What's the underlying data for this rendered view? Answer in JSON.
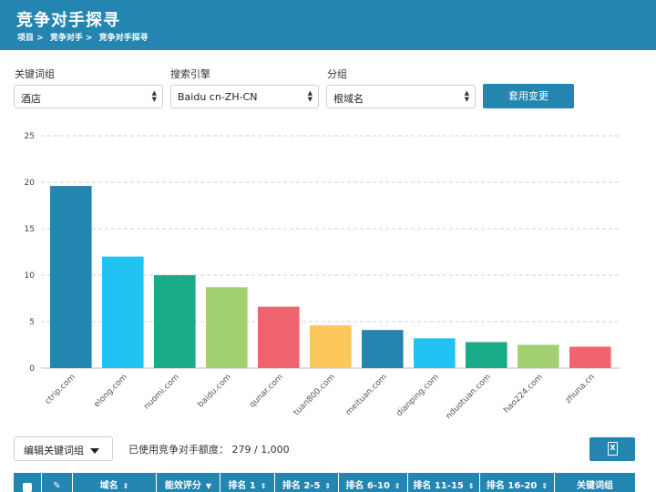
{
  "header": {
    "title": "竞争对手探寻",
    "breadcrumb": [
      "项目 >",
      "竞争对手 >",
      "竞争对手探寻"
    ]
  },
  "filters": {
    "keyword_group": {
      "label": "关键词组",
      "value": "酒店"
    },
    "search_engine": {
      "label": "搜索引擎",
      "value": "Baidu cn-ZH-CN"
    },
    "grouping": {
      "label": "分组",
      "value": "根域名"
    },
    "apply_label": "套用变更"
  },
  "chart_data": {
    "type": "bar",
    "categories": [
      "ctrip.com",
      "elong.com",
      "nuomi.com",
      "baidu.com",
      "qunar.com",
      "tuan800.com",
      "meituan.com",
      "dianping.com",
      "nduotuan.com",
      "hao224.com",
      "zhuna.cn"
    ],
    "values": [
      19.6,
      12.0,
      10.0,
      8.7,
      6.6,
      4.6,
      4.1,
      3.2,
      2.8,
      2.5,
      2.3
    ],
    "colors": [
      "#2485b0",
      "#21c3f3",
      "#1aab88",
      "#a2cf6f",
      "#f0646f",
      "#fcc75b",
      "#2485b0",
      "#21c3f3",
      "#1aab88",
      "#a2cf6f",
      "#f0646f"
    ],
    "ylim": [
      0,
      25
    ],
    "yticks": [
      0,
      5,
      10,
      15,
      20,
      25
    ],
    "grid": true,
    "legend": "none"
  },
  "toolbar": {
    "edit_label": "编辑关键词组",
    "quota_text": "已使用竞争对手额度： 279 / 1,000",
    "export_icon": "excel-export-icon"
  },
  "table": {
    "columns": [
      "域名",
      "能效评分",
      "排名 1",
      "排名 2-5",
      "排名 6-10",
      "排名 11-15",
      "排名 16-20",
      "关键词组"
    ]
  }
}
